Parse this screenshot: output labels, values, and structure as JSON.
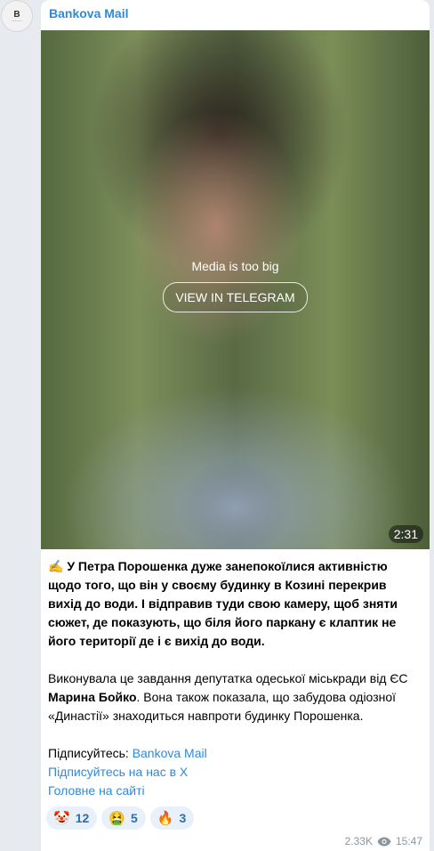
{
  "channel": {
    "name": "Bankova Mail",
    "avatar_text": "B"
  },
  "media": {
    "message": "Media is too big",
    "button_label": "VIEW IN TELEGRAM",
    "duration": "2:31"
  },
  "post": {
    "para1": {
      "emoji": "✍️",
      "text": " У Петра Порошенка дуже занепокоїлися активністю щодо того, що він у своєму будинку в Козині перекрив вихід до води. І відправив туди свою камеру, щоб зняти сюжет, де показують, що біля його паркану є клаптик не його території де і є вихід до води."
    },
    "para2": {
      "before": "Виконувала це завдання депутатка одеської міськради від ЄС ",
      "bold": "Марина Бойко",
      "after": ". Вона також показала, що забудова одіозної «Династії» знаходиться навпроти будинку Порошенка."
    },
    "subscribe": {
      "label": "Підписуйтесь: ",
      "link": "Bankova Mail"
    },
    "link_x": "Підписуйтесь на нас в X",
    "link_site": "Головне на сайті"
  },
  "reactions": [
    {
      "emoji": "🤡",
      "count": "12"
    },
    {
      "emoji": "🤮",
      "count": "5"
    },
    {
      "emoji": "🔥",
      "count": "3"
    }
  ],
  "meta": {
    "views": "2.33K",
    "time": "15:47"
  }
}
